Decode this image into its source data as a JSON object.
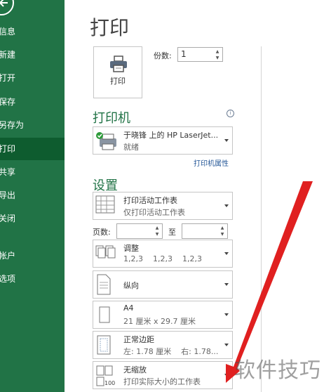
{
  "sidebar": {
    "items": [
      {
        "label": "信息"
      },
      {
        "label": "新建"
      },
      {
        "label": "打开"
      },
      {
        "label": "保存"
      },
      {
        "label": "另存为"
      },
      {
        "label": "打印",
        "active": true
      },
      {
        "label": "共享"
      },
      {
        "label": "导出"
      },
      {
        "label": "关闭"
      },
      {
        "label": "帐户"
      },
      {
        "label": "选项"
      }
    ]
  },
  "page": {
    "title": "打印"
  },
  "print_button": {
    "label": "打印",
    "icon": "printer-icon"
  },
  "copies": {
    "label": "份数:",
    "value": "1"
  },
  "printer": {
    "section_title": "打印机",
    "name": "于晓锋 上的 HP LaserJet...",
    "status": "就绪",
    "properties_link": "打印机属性"
  },
  "settings": {
    "section_title": "设置",
    "print_what": {
      "title": "打印活动工作表",
      "subtitle": "仅打印活动工作表"
    },
    "pages_label": "页数:",
    "to_label": "至",
    "collate": {
      "title": "调整",
      "subtitle": "1,2,3    1,2,3    1,2,3"
    },
    "orientation": {
      "title": "纵向"
    },
    "paper": {
      "title": "A4",
      "subtitle": "21 厘米 x 29.7 厘米"
    },
    "margins": {
      "title": "正常边距",
      "subtitle": "左: 1.78 厘米    右: 1.78..."
    },
    "scaling": {
      "title": "无缩放",
      "subtitle": "打印实际大小的工作表"
    }
  },
  "watermark": "软件技巧",
  "colors": {
    "accent": "#217346",
    "active_nav": "#0e5c2f",
    "annotation": "#e02020"
  }
}
